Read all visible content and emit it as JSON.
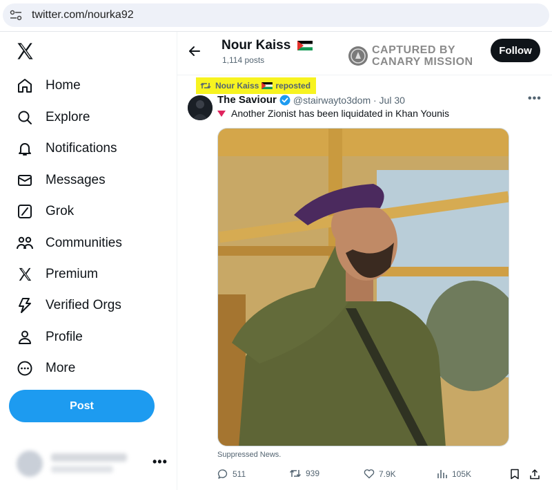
{
  "browser": {
    "url": "twitter.com/nourka92"
  },
  "sidebar": {
    "items": [
      {
        "label": "Home",
        "icon": "home-icon"
      },
      {
        "label": "Explore",
        "icon": "search-icon"
      },
      {
        "label": "Notifications",
        "icon": "bell-icon"
      },
      {
        "label": "Messages",
        "icon": "envelope-icon"
      },
      {
        "label": "Grok",
        "icon": "grok-icon"
      },
      {
        "label": "Communities",
        "icon": "people-icon"
      },
      {
        "label": "Premium",
        "icon": "x-icon"
      },
      {
        "label": "Verified Orgs",
        "icon": "lightning-icon"
      },
      {
        "label": "Profile",
        "icon": "person-icon"
      },
      {
        "label": "More",
        "icon": "more-circle-icon"
      }
    ],
    "post_label": "Post",
    "account_more": "•••"
  },
  "profile": {
    "name": "Nour Kaiss",
    "posts_count": "1,114 posts",
    "follow_label": "Follow"
  },
  "watermark": {
    "line1": "CAPTURED BY",
    "line2": "CANARY MISSION"
  },
  "tweet": {
    "repost_by": "Nour Kaiss",
    "repost_suffix": "reposted",
    "author_name": "The Saviour",
    "author_meta": "@stairwayto3dom · Jul 30",
    "text": "Another Zionist has been liquidated in Khan Younis",
    "more": "•••",
    "caption": "Suppressed News.",
    "replies": "511",
    "reposts": "939",
    "likes": "7.9K",
    "views": "105K"
  },
  "colors": {
    "accent": "#1d9bf0",
    "highlight": "#f7f320",
    "text": "#0f1419",
    "muted": "#536471"
  }
}
